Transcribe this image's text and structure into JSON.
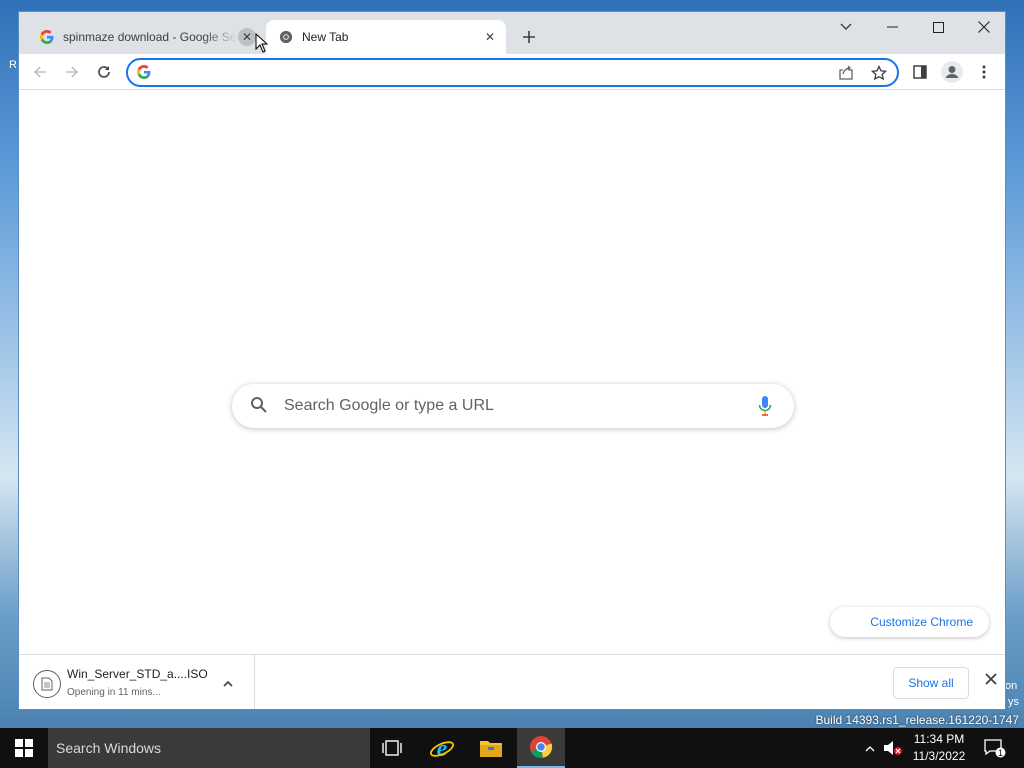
{
  "desktop": {
    "left_fragment": "R",
    "right_fragment_1": "on",
    "right_fragment_2": "ys",
    "build_text": "Build 14393.rs1_release.161220-1747"
  },
  "browser": {
    "tabs": [
      {
        "title": "spinmaze download - Google Se",
        "favicon": "google-g-icon",
        "active": false
      },
      {
        "title": "New Tab",
        "favicon": "chrome-icon",
        "active": true
      }
    ],
    "omnibox": {
      "value": "",
      "placeholder": ""
    },
    "new_tab_page": {
      "search_placeholder": "Search Google or type a URL",
      "customize_label": "Customize Chrome"
    },
    "download_shelf": {
      "file_name": "Win_Server_STD_a....ISO",
      "status": "Opening in 11 mins...",
      "show_all_label": "Show all"
    }
  },
  "taskbar": {
    "search_placeholder": "Search Windows",
    "time": "11:34 PM",
    "date": "11/3/2022",
    "notification_count": "1"
  },
  "colors": {
    "accent": "#1a73e8",
    "tab_strip": "#dee1e6",
    "taskbar": "#101010"
  }
}
